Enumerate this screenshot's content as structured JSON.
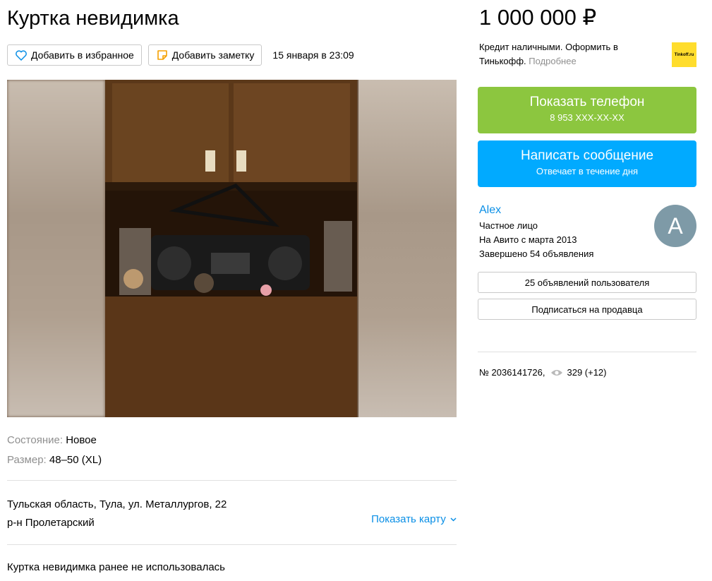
{
  "listing": {
    "title": "Куртка невидимка",
    "favorite_label": "Добавить в избранное",
    "note_label": "Добавить заметку",
    "date": "15 января в 23:09",
    "params": [
      {
        "key": "Состояние:",
        "value": "Новое"
      },
      {
        "key": "Размер:",
        "value": "48–50 (XL)"
      }
    ],
    "address_line1": "Тульская область, Тула, ул. Металлургов, 22",
    "address_line2": "р-н Пролетарский",
    "show_map": "Показать карту",
    "description": "Куртка невидимка ранее не использовалась"
  },
  "sidebar": {
    "price": "1 000 000 ₽",
    "credit_text": "Кредит наличными. Оформить в Тинькофф.",
    "credit_more": "Подробнее",
    "bank_logo_text": "Tinkoff.ru",
    "phone_button": {
      "title": "Показать телефон",
      "subtitle": "8 953 XXX-XX-XX"
    },
    "message_button": {
      "title": "Написать сообщение",
      "subtitle": "Отвечает в течение дня"
    },
    "seller": {
      "name": "Alex",
      "type": "Частное лицо",
      "since": "На Авито с марта 2013",
      "completed": "Завершено 54 объявления",
      "avatar_letter": "A"
    },
    "user_ads_button": "25 объявлений пользователя",
    "subscribe_button": "Подписаться на продавца",
    "ad_number": "№ 2036141726,",
    "views": "329 (+12)"
  },
  "colors": {
    "green": "#8cc63f",
    "blue": "#01aaff",
    "link": "#0a8fe6",
    "avatar": "#7e9aa7",
    "tinkoff": "#ffdd2d"
  },
  "icons": [
    "heart-icon",
    "note-icon",
    "chevron-down-icon",
    "eye-icon"
  ]
}
